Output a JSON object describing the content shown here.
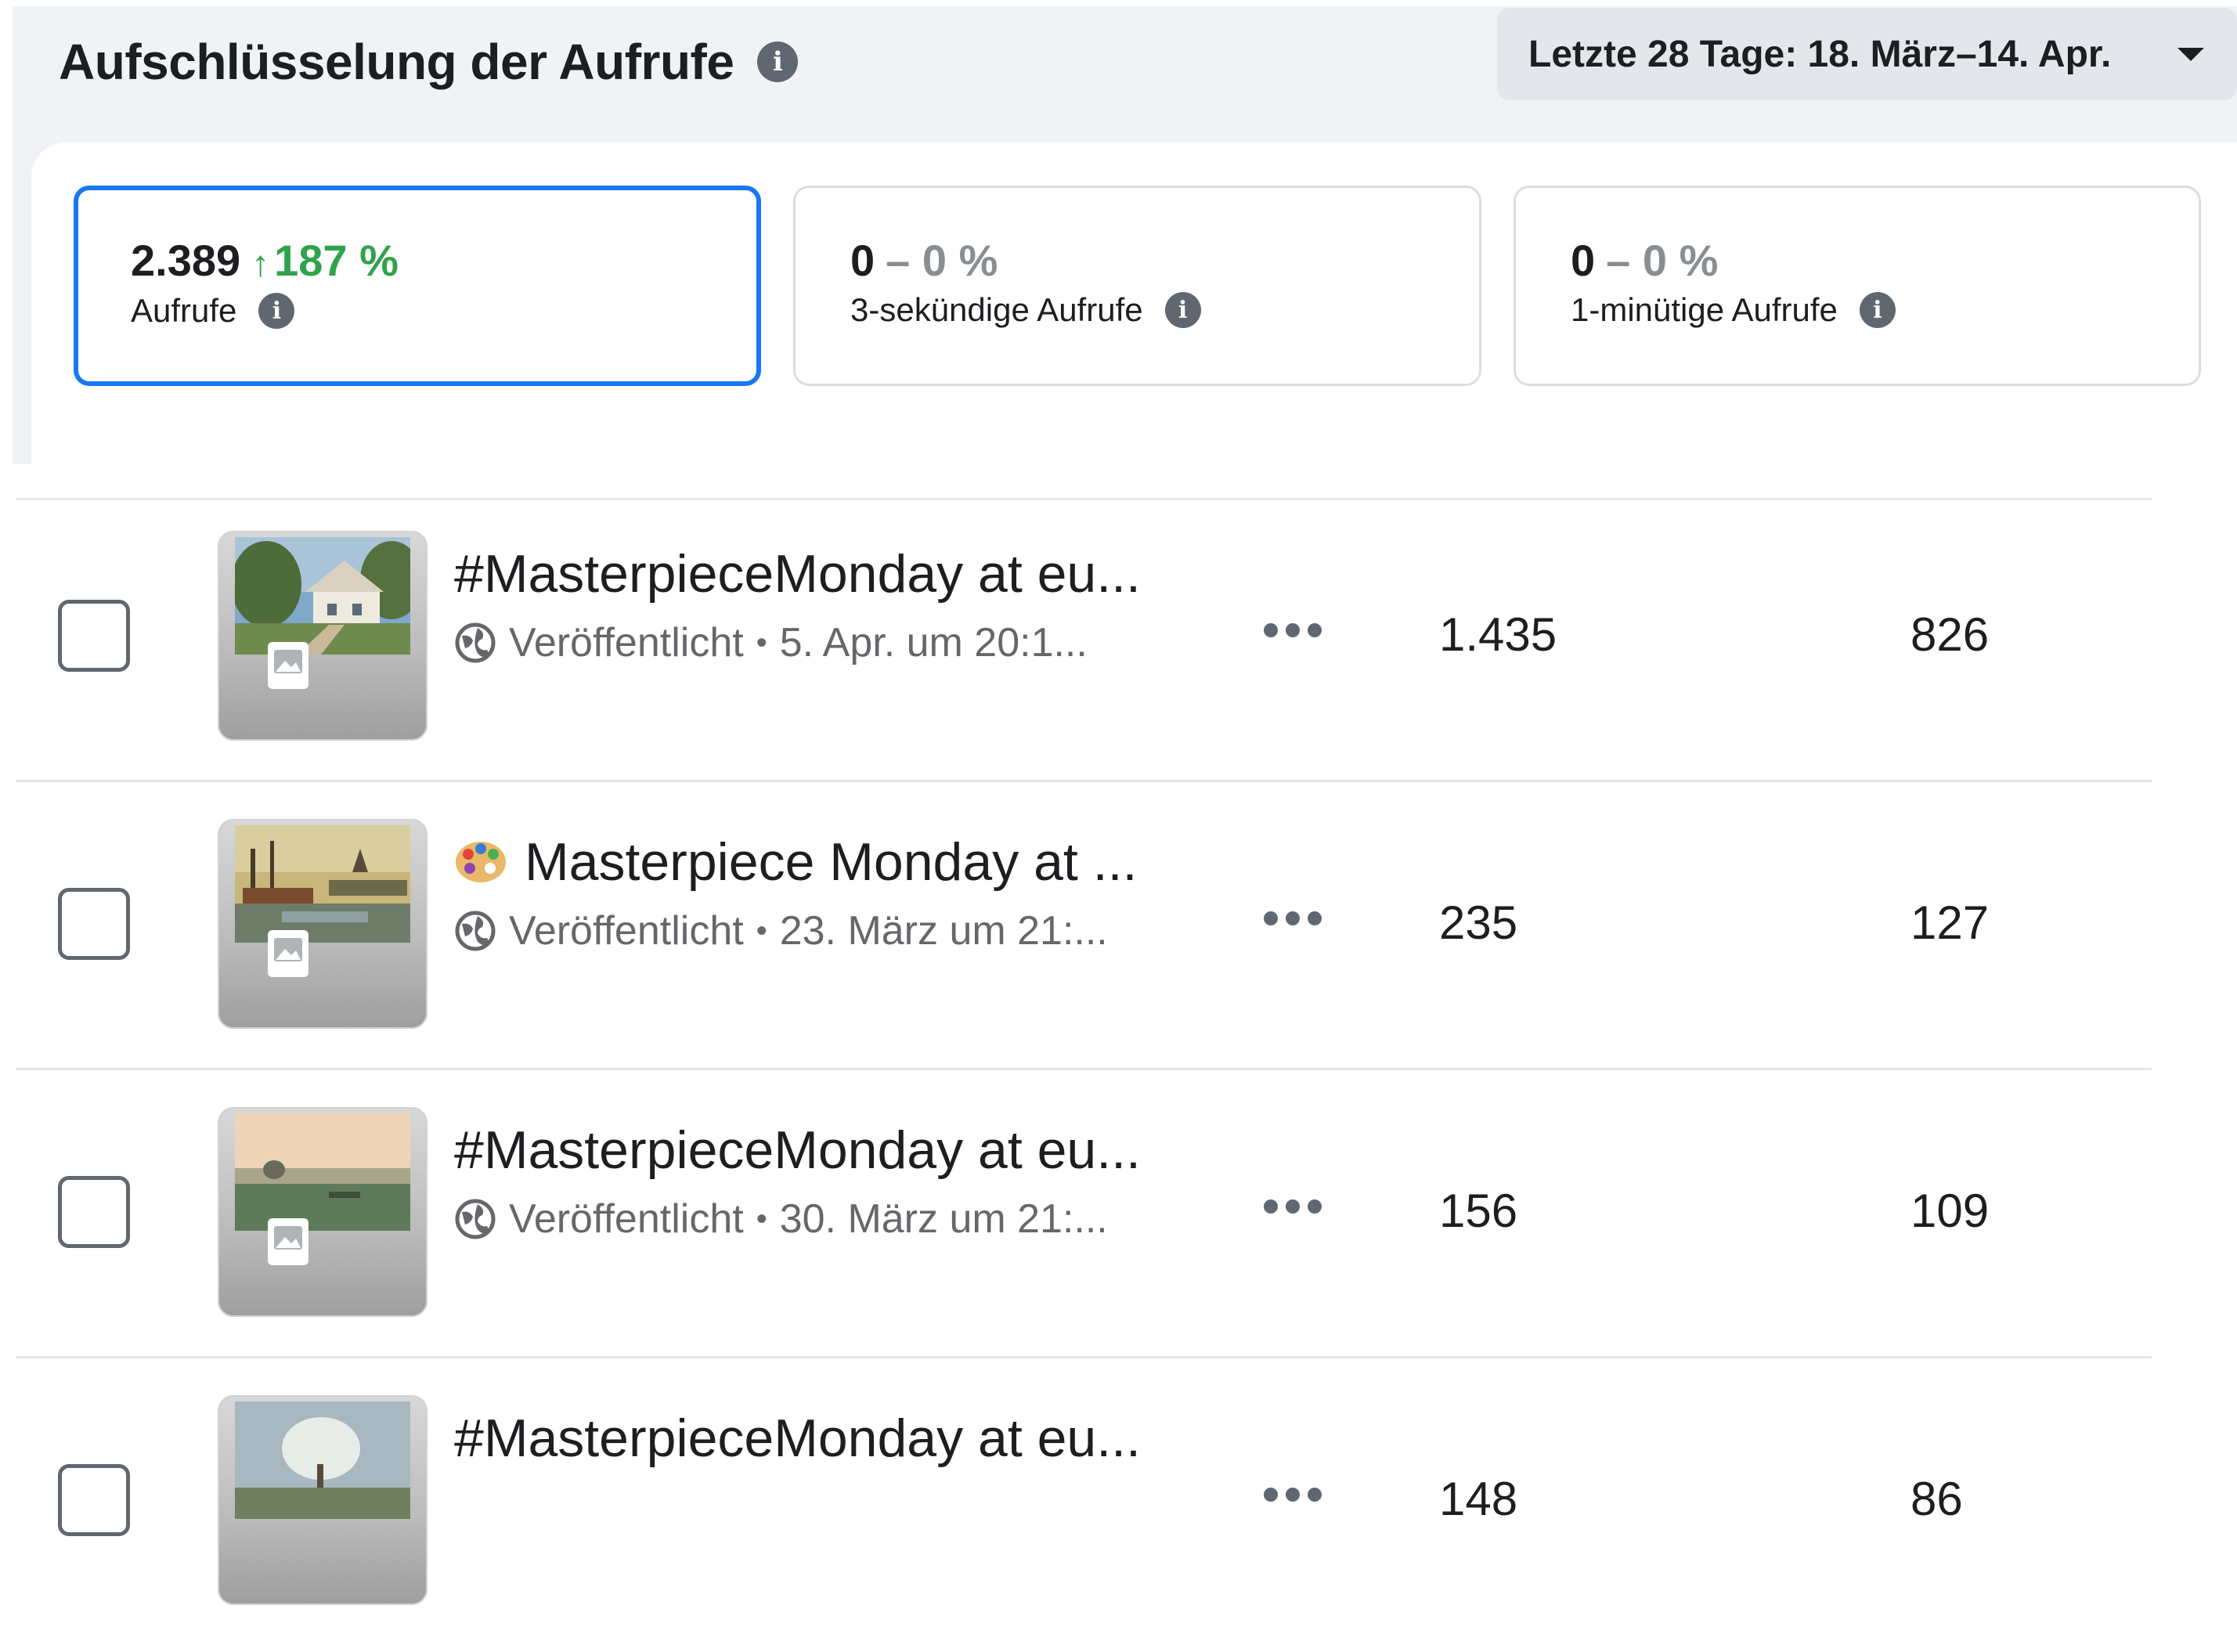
{
  "header": {
    "title": "Aufschlüsselung der Aufrufe",
    "date_range": "Letzte 28 Tage: 18. März–14. Apr."
  },
  "metrics": [
    {
      "value": "2.389",
      "delta": "187 %",
      "trend": "up",
      "label": "Aufrufe",
      "selected": true
    },
    {
      "value": "0",
      "delta": "– 0 %",
      "trend": "flat",
      "label": "3-sekündige Aufrufe",
      "selected": false
    },
    {
      "value": "0",
      "delta": "– 0 %",
      "trend": "flat",
      "label": "1-minütige Aufrufe",
      "selected": false
    }
  ],
  "posts": [
    {
      "title": "#MasterpieceMonday at eu...",
      "status": "Veröffentlicht",
      "date": "5. Apr. um 20:1...",
      "col_a": "1.435",
      "col_b": "826",
      "thumb": "cottage"
    },
    {
      "title": "Masterpiece Monday at ...",
      "status": "Veröffentlicht",
      "date": "23. März um 21:...",
      "col_a": "235",
      "col_b": "127",
      "thumb": "harbor",
      "emoji_icon": "palette-icon"
    },
    {
      "title": "#MasterpieceMonday at eu...",
      "status": "Veröffentlicht",
      "date": "30. März um 21:...",
      "col_a": "156",
      "col_b": "109",
      "thumb": "meadow"
    },
    {
      "title": "#MasterpieceMonday at eu...",
      "status": "",
      "date": "",
      "col_a": "148",
      "col_b": "86",
      "thumb": "orchard"
    }
  ],
  "colors": {
    "accent_blue": "#1877f2",
    "positive_green": "#31a24c",
    "muted_text": "#65676b",
    "panel_bg": "#f0f2f5"
  }
}
